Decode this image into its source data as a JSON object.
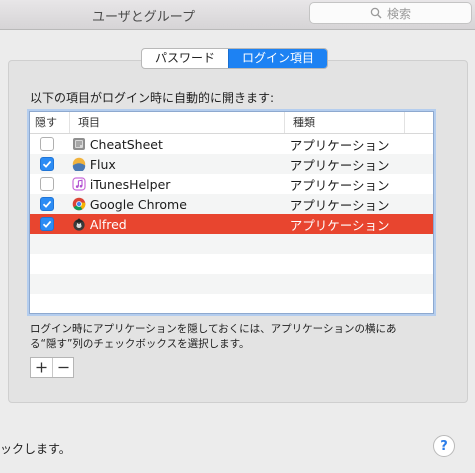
{
  "window": {
    "title": "ユーザとグループ",
    "search_placeholder": "検索",
    "search_icon": "magnifying-glass-icon"
  },
  "tabs": [
    {
      "label": "パスワード",
      "selected": false
    },
    {
      "label": "ログイン項目",
      "selected": true
    }
  ],
  "login_items": {
    "intro": "以下の項目がログイン時に自動的に開きます:",
    "columns": {
      "hide": "隠す",
      "item": "項目",
      "kind": "種類"
    },
    "rows": [
      {
        "hide": false,
        "name": "CheatSheet",
        "kind": "アプリケーション",
        "icon": "cheatsheet-app-icon",
        "selected": false
      },
      {
        "hide": true,
        "name": "Flux",
        "kind": "アプリケーション",
        "icon": "flux-app-icon",
        "selected": false
      },
      {
        "hide": false,
        "name": "iTunesHelper",
        "kind": "アプリケーション",
        "icon": "itunes-helper-icon",
        "selected": false
      },
      {
        "hide": true,
        "name": "Google Chrome",
        "kind": "アプリケーション",
        "icon": "chrome-icon",
        "selected": false
      },
      {
        "hide": true,
        "name": "Alfred",
        "kind": "アプリケーション",
        "icon": "alfred-icon",
        "selected": true
      }
    ],
    "help_text_line1": "ログイン時にアプリケーションを隠しておくには、アプリケーションの横にあ",
    "help_text_line2": "る“隠す”列のチェックボックスを選択します。",
    "add_label": "+",
    "remove_label": "−"
  },
  "footer": {
    "partial_text": "ックします。",
    "help_label": "?"
  },
  "colors": {
    "accent": "#1d82f3",
    "selection": "#e8452f",
    "checkbox_on": "#2c8cf4"
  }
}
